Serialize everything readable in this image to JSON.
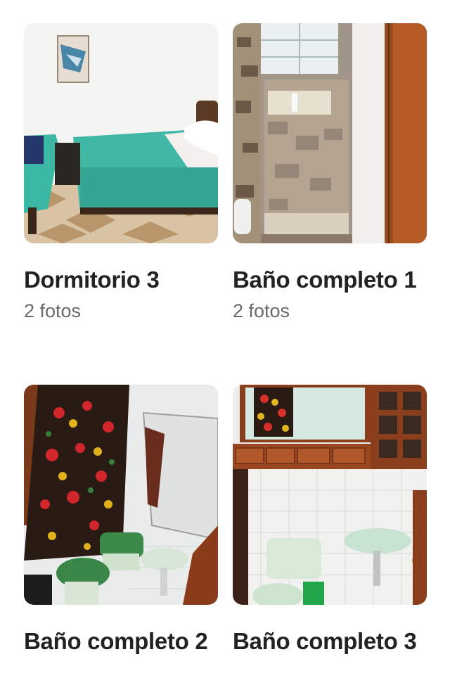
{
  "rooms": [
    {
      "title": "Dormitorio 3",
      "count": "2 fotos",
      "photo": "bedroom-photo"
    },
    {
      "title": "Baño completo 1",
      "count": "2 fotos",
      "photo": "bathroom-photo"
    },
    {
      "title": "Baño completo 2",
      "count": "",
      "photo": "bathroom-photo"
    },
    {
      "title": "Baño completo 3",
      "count": "",
      "photo": "bathroom-photo"
    }
  ]
}
